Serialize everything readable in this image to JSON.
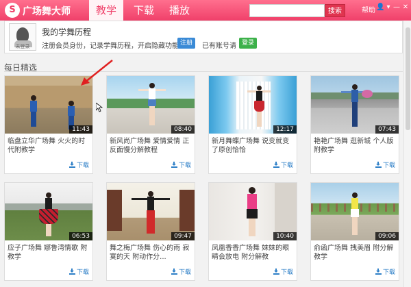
{
  "header": {
    "logo_char": "S",
    "app_title": "广场舞大师",
    "tabs": [
      {
        "label": "教学",
        "active": true
      },
      {
        "label": "下载",
        "active": false
      },
      {
        "label": "播放",
        "active": false
      }
    ],
    "search_value": "",
    "search_button": "搜索",
    "help": "帮助",
    "window_controls": [
      "👤",
      "▾",
      "—",
      "✕"
    ]
  },
  "profile": {
    "avatar_label": "未登录",
    "title": "我的学舞历程",
    "desc": "注册会员身份，记录学舞历程，开启隐藏功能。",
    "register_button": "注册",
    "has_account": "已有账号请",
    "login_button": "登录"
  },
  "section_title": "每日精选",
  "download_label": "下载",
  "videos": [
    {
      "title": "临盘立华广场舞 火火的时代附教学",
      "duration": "11:43"
    },
    {
      "title": "新风尚广场舞 爱情爱情 正反面慢分解教程",
      "duration": "08:40"
    },
    {
      "title": "新月舞蝶广场舞 说变就变了原创恰恰",
      "duration": "12:17"
    },
    {
      "title": "艳艳广场舞 逛新城 个人版附教学",
      "duration": "07:43"
    },
    {
      "title": "应子广场舞 娜鲁湾情歌 附教学",
      "duration": "06:53"
    },
    {
      "title": "舞之梅广场舞 伤心的雨 寂寞的天 附动作分...",
      "duration": "09:47"
    },
    {
      "title": "凤凰香香广场舞 妹妹的眼睛会放电 附分解教",
      "duration": "10:40"
    },
    {
      "title": "俞函广场舞 拽美眉 附分解教学",
      "duration": "09:06"
    }
  ]
}
